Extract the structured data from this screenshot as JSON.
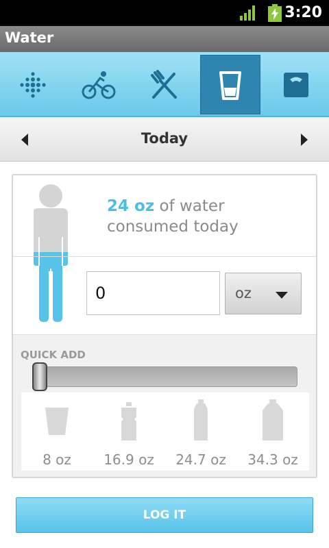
{
  "status_bar": {
    "time": "3:20"
  },
  "app": {
    "title": "Water"
  },
  "tabs": [
    {
      "icon": "activity-dots-icon",
      "active": false
    },
    {
      "icon": "bike-icon",
      "active": false
    },
    {
      "icon": "fork-knife-icon",
      "active": false
    },
    {
      "icon": "water-glass-icon",
      "active": true
    },
    {
      "icon": "scale-icon",
      "active": false
    }
  ],
  "date_nav": {
    "label": "Today"
  },
  "summary": {
    "amount": "24 oz",
    "text_line1": " of water",
    "text_line2": "consumed today"
  },
  "entry": {
    "value": "0",
    "unit": "oz"
  },
  "quick_add": {
    "label": "QUICK ADD",
    "slider_value": 0,
    "containers": [
      {
        "icon": "glass-icon",
        "label": "8 oz"
      },
      {
        "icon": "sport-bottle-icon",
        "label": "16.9 oz"
      },
      {
        "icon": "bottle-icon",
        "label": "24.7 oz"
      },
      {
        "icon": "large-bottle-icon",
        "label": "34.3 oz"
      }
    ]
  },
  "actions": {
    "log_label": "LOG IT"
  },
  "colors": {
    "accent": "#4bbfe3",
    "tab_active": "#2e86b0"
  }
}
